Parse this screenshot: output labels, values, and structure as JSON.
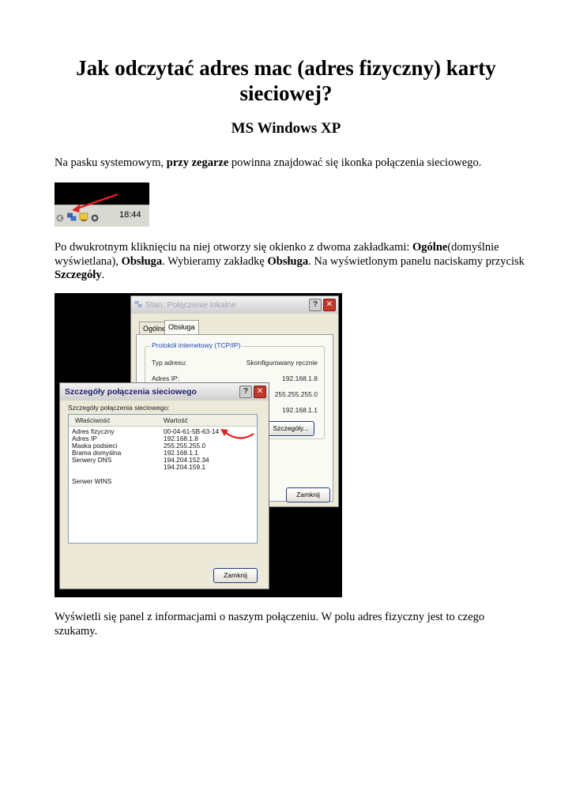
{
  "document": {
    "title": "Jak odczytać adres mac (adres fizyczny) karty sieciowej?",
    "subtitle": "MS Windows XP",
    "paragraph1": {
      "before": "Na pasku systemowym, ",
      "bold": "przy zegarze",
      "after": " powinna znajdować się ikonka połączenia sieciowego."
    },
    "paragraph2": {
      "t1": "Po dwukrotnym kliknięciu na niej otworzy się okienko z dwoma zakładkami: ",
      "b1": "Ogólne",
      "t2": "(domyślnie wyświetlana), ",
      "b2": "Obsługa",
      "t3": ". Wybieramy zakładkę ",
      "b3": "Obsługa",
      "t4": ". Na wyświetlonym panelu naciskamy przycisk ",
      "b4": "Szczegóły",
      "t5": "."
    },
    "paragraph3": "Wyświetli się panel z informacjami o naszym połączeniu. W polu adres fizyczny jest to czego szukamy."
  },
  "taskbar": {
    "clock": "18:44",
    "arrow_color": "#e02020"
  },
  "status_window": {
    "title": "Stan: Połączenie lokalne",
    "help": "?",
    "close": "✕",
    "tabs": [
      "Ogólne",
      "Obsługa"
    ],
    "active_tab": "Obsługa",
    "group_label": "Protokół internetowy (TCP/IP)",
    "rows": [
      {
        "label": "Typ adresu:",
        "value": "Skonfigurowany ręcznie"
      },
      {
        "label": "Adres IP:",
        "value": "192.168.1.8"
      },
      {
        "label": "",
        "value": "255.255.255.0"
      },
      {
        "label": "",
        "value": "192.168.1.1"
      }
    ],
    "details_button": "Szczegóły...",
    "close_button": "Zamknij"
  },
  "details_window": {
    "title": "Szczegóły połączenia sieciowego",
    "help": "?",
    "close": "✕",
    "caption": "Szczegóły połączenia sieciowego:",
    "columns": [
      "Właściwość",
      "Wartość"
    ],
    "rows": [
      {
        "name": "Adres fizyczny",
        "value": "00-04-61-5B-63-14"
      },
      {
        "name": "Adres IP",
        "value": "192.168.1.8"
      },
      {
        "name": "Maska podsieci",
        "value": "255.255.255.0"
      },
      {
        "name": "Brama domyślna",
        "value": "192.168.1.1"
      },
      {
        "name": "Serwery DNS",
        "value": "194.204.152.34"
      },
      {
        "name": "",
        "value": "194.204.159.1"
      },
      {
        "name": "",
        "value": ""
      },
      {
        "name": "Serwer WINS",
        "value": ""
      }
    ],
    "close_button": "Zamknij",
    "arrow_color": "#e02020"
  }
}
